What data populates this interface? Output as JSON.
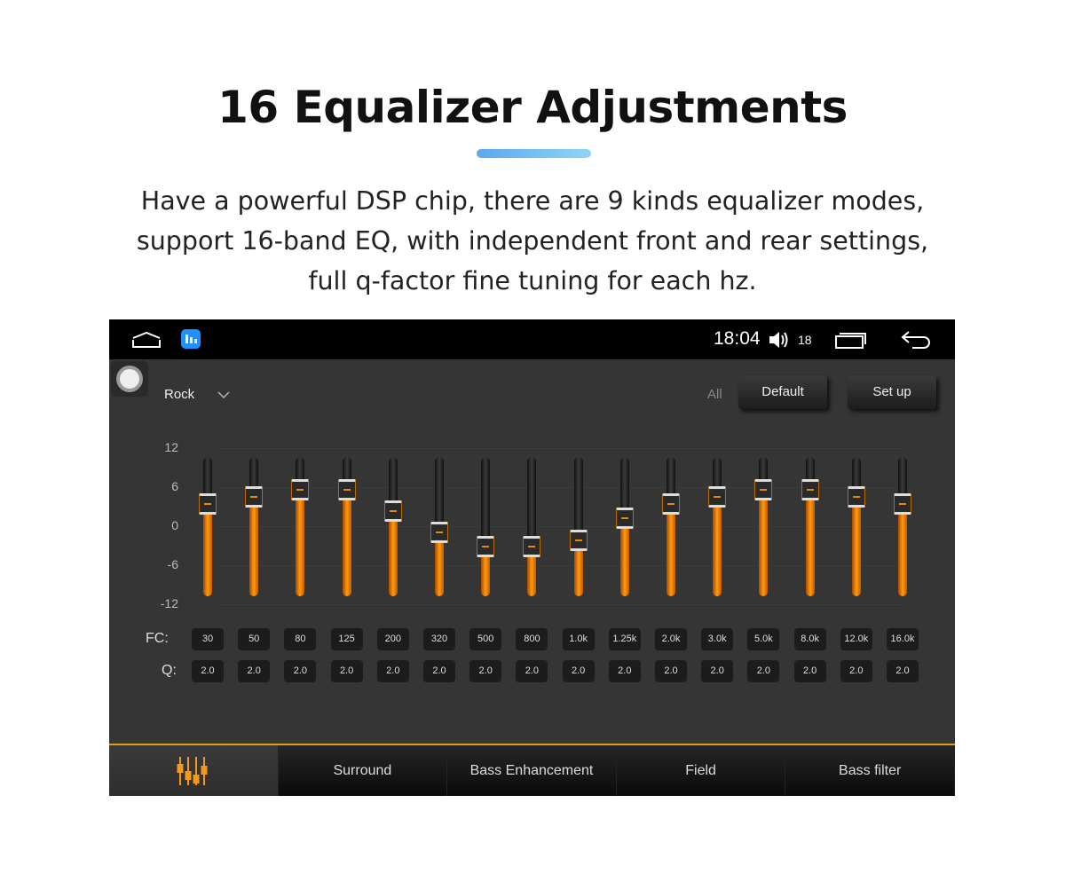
{
  "header": {
    "title": "16 Equalizer Adjustments",
    "subtitle_lines": [
      "Have a powerful DSP chip, there are 9 kinds equalizer modes,",
      "support 16-band EQ, with independent front and rear settings,",
      "full q-factor fine tuning for each hz."
    ]
  },
  "status_bar": {
    "time": "18:04",
    "volume": "18",
    "icons": [
      "home-icon",
      "app-icon",
      "volume-icon",
      "recent-apps-icon",
      "back-icon"
    ]
  },
  "eq": {
    "preset": "Rock",
    "all_label": "All",
    "default_label": "Default",
    "setup_label": "Set up",
    "axis_labels": [
      "12",
      "6",
      "0",
      "-6",
      "-12"
    ],
    "range": [
      -12,
      12
    ],
    "accent": "#ff9a10",
    "fc_label": "FC:",
    "q_label": "Q:",
    "bands": [
      {
        "fc": "30",
        "q": "2.0",
        "gain": 3.4
      },
      {
        "fc": "50",
        "q": "2.0",
        "gain": 4.5
      },
      {
        "fc": "80",
        "q": "2.0",
        "gain": 5.6
      },
      {
        "fc": "125",
        "q": "2.0",
        "gain": 5.6
      },
      {
        "fc": "200",
        "q": "2.0",
        "gain": 2.3
      },
      {
        "fc": "320",
        "q": "2.0",
        "gain": -1
      },
      {
        "fc": "500",
        "q": "2.0",
        "gain": -3.1
      },
      {
        "fc": "800",
        "q": "2.0",
        "gain": -3.1
      },
      {
        "fc": "1.0k",
        "q": "2.0",
        "gain": -2.2
      },
      {
        "fc": "1.25k",
        "q": "2.0",
        "gain": 1.2
      },
      {
        "fc": "2.0k",
        "q": "2.0",
        "gain": 3.4
      },
      {
        "fc": "3.0k",
        "q": "2.0",
        "gain": 4.5
      },
      {
        "fc": "5.0k",
        "q": "2.0",
        "gain": 5.6
      },
      {
        "fc": "8.0k",
        "q": "2.0",
        "gain": 5.6
      },
      {
        "fc": "12.0k",
        "q": "2.0",
        "gain": 4.5
      },
      {
        "fc": "16.0k",
        "q": "2.0",
        "gain": 3.4
      }
    ]
  },
  "tabs": [
    {
      "label": "",
      "icon": "equalizer-icon",
      "active": true
    },
    {
      "label": "Surround"
    },
    {
      "label": "Bass Enhancement"
    },
    {
      "label": "Field"
    },
    {
      "label": "Bass filter"
    }
  ]
}
